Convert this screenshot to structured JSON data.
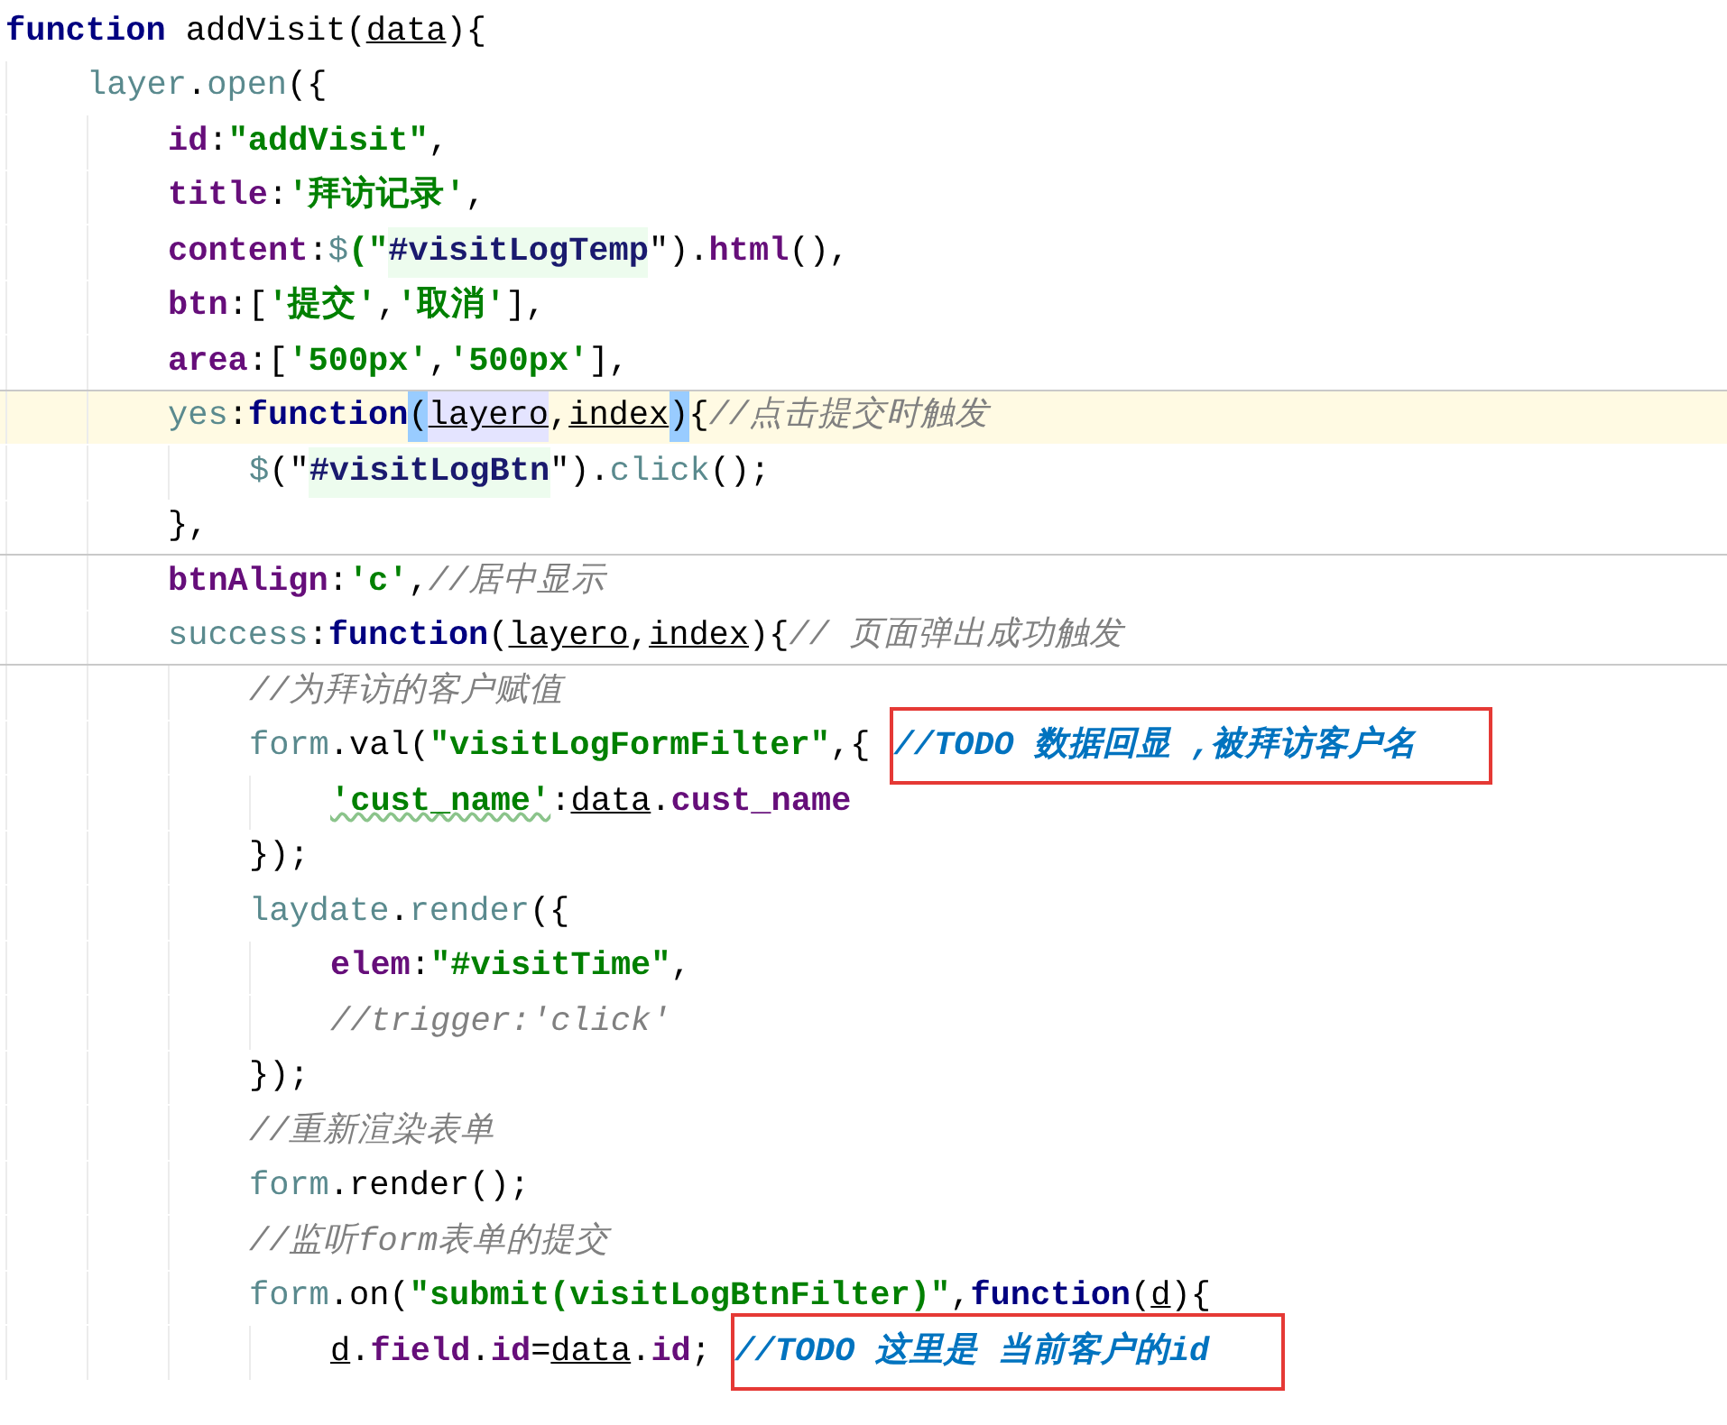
{
  "code_lines": [
    {
      "tokens": [
        {
          "text": "function",
          "kind": "keyword"
        },
        {
          "text": " addVisit(",
          "kind": "plain"
        },
        {
          "text": "data",
          "kind": "param"
        },
        {
          "text": "){",
          "kind": "plain"
        }
      ],
      "children": [
        {
          "tokens": [
            {
              "text": "layer",
              "kind": "ident"
            },
            {
              "text": ".",
              "kind": "plain"
            },
            {
              "text": "open",
              "kind": "ident"
            },
            {
              "text": "({",
              "kind": "plain"
            }
          ],
          "children": [
            {
              "tokens": [
                {
                  "text": "id",
                  "kind": "prop"
                },
                {
                  "text": ":",
                  "kind": "plain"
                },
                {
                  "text": "\"addVisit\"",
                  "kind": "string"
                },
                {
                  "text": ",",
                  "kind": "plain"
                }
              ]
            },
            {
              "tokens": [
                {
                  "text": "title",
                  "kind": "prop"
                },
                {
                  "text": ":",
                  "kind": "plain"
                },
                {
                  "text": "'拜访记录'",
                  "kind": "string"
                },
                {
                  "text": ",",
                  "kind": "plain"
                }
              ]
            },
            {
              "tokens": [
                {
                  "text": "content",
                  "kind": "prop"
                },
                {
                  "text": ":",
                  "kind": "plain"
                },
                {
                  "text": "$",
                  "kind": "ident"
                },
                {
                  "text": "(\"",
                  "kind": "string"
                },
                {
                  "text": "#visitLogTemp",
                  "kind": "selector"
                },
                {
                  "text": "\").",
                  "kind": "plain"
                },
                {
                  "text": "html",
                  "kind": "prop"
                },
                {
                  "text": "(),",
                  "kind": "plain"
                }
              ]
            },
            {
              "tokens": [
                {
                  "text": "btn",
                  "kind": "prop"
                },
                {
                  "text": ":[",
                  "kind": "plain"
                },
                {
                  "text": "'提交'",
                  "kind": "string"
                },
                {
                  "text": ",",
                  "kind": "plain"
                },
                {
                  "text": "'取消'",
                  "kind": "string"
                },
                {
                  "text": "],",
                  "kind": "plain"
                }
              ]
            },
            {
              "tokens": [
                {
                  "text": "area",
                  "kind": "prop"
                },
                {
                  "text": ":[",
                  "kind": "plain"
                },
                {
                  "text": "'500px'",
                  "kind": "string"
                },
                {
                  "text": ",",
                  "kind": "plain"
                },
                {
                  "text": "'500px'",
                  "kind": "string"
                },
                {
                  "text": "],",
                  "kind": "plain"
                }
              ]
            },
            {
              "current": true,
              "separator_above": true,
              "tokens": [
                {
                  "text": "yes",
                  "kind": "ident"
                },
                {
                  "text": ":",
                  "kind": "plain"
                },
                {
                  "text": "function",
                  "kind": "keyword"
                },
                {
                  "text": "(",
                  "kind": "brace_match"
                },
                {
                  "text": "layero",
                  "kind": "param_highlight"
                },
                {
                  "text": ",",
                  "kind": "plain"
                },
                {
                  "text": "index",
                  "kind": "param"
                },
                {
                  "text": ")",
                  "kind": "brace_match"
                },
                {
                  "text": "{",
                  "kind": "plain"
                },
                {
                  "text": "//点击提交时触发",
                  "kind": "comment"
                }
              ],
              "children": [
                {
                  "tokens": [
                    {
                      "text": "$",
                      "kind": "ident"
                    },
                    {
                      "text": "(\"",
                      "kind": "plain"
                    },
                    {
                      "text": "#visitLogBtn",
                      "kind": "selector"
                    },
                    {
                      "text": "\").",
                      "kind": "plain"
                    },
                    {
                      "text": "click",
                      "kind": "ident"
                    },
                    {
                      "text": "();",
                      "kind": "plain"
                    }
                  ]
                }
              ]
            },
            {
              "tokens": [
                {
                  "text": "},",
                  "kind": "plain"
                }
              ]
            },
            {
              "separator_above": true,
              "tokens": [
                {
                  "text": "btnAlign",
                  "kind": "prop"
                },
                {
                  "text": ":",
                  "kind": "plain"
                },
                {
                  "text": "'c'",
                  "kind": "string"
                },
                {
                  "text": ",",
                  "kind": "plain"
                },
                {
                  "text": "//居中显示",
                  "kind": "comment"
                }
              ]
            },
            {
              "tokens": [
                {
                  "text": "success",
                  "kind": "ident"
                },
                {
                  "text": ":",
                  "kind": "plain"
                },
                {
                  "text": "function",
                  "kind": "keyword"
                },
                {
                  "text": "(",
                  "kind": "plain"
                },
                {
                  "text": "layero",
                  "kind": "param"
                },
                {
                  "text": ",",
                  "kind": "plain"
                },
                {
                  "text": "index",
                  "kind": "param"
                },
                {
                  "text": "){",
                  "kind": "plain"
                },
                {
                  "text": "// 页面弹出成功触发",
                  "kind": "comment"
                }
              ],
              "children": [
                {
                  "separator_above": true,
                  "tokens": [
                    {
                      "text": "//为拜访的客户赋值",
                      "kind": "comment"
                    }
                  ]
                },
                {
                  "tokens": [
                    {
                      "text": "form",
                      "kind": "ident"
                    },
                    {
                      "text": ".val(",
                      "kind": "plain"
                    },
                    {
                      "text": "\"visitLogFormFilter\"",
                      "kind": "string"
                    },
                    {
                      "text": ",{ ",
                      "kind": "plain"
                    },
                    {
                      "text": "//TODO 数据回显 ,被拜访客户名",
                      "kind": "todo",
                      "boxed": true
                    }
                  ],
                  "children": [
                    {
                      "tokens": [
                        {
                          "text": "'cust_name'",
                          "kind": "string_warn"
                        },
                        {
                          "text": ":",
                          "kind": "plain"
                        },
                        {
                          "text": "data",
                          "kind": "param"
                        },
                        {
                          "text": ".",
                          "kind": "plain"
                        },
                        {
                          "text": "cust_name",
                          "kind": "prop"
                        }
                      ]
                    }
                  ]
                },
                {
                  "tokens": [
                    {
                      "text": "});",
                      "kind": "plain"
                    }
                  ]
                },
                {
                  "tokens": [
                    {
                      "text": "laydate",
                      "kind": "ident"
                    },
                    {
                      "text": ".",
                      "kind": "plain"
                    },
                    {
                      "text": "render",
                      "kind": "ident"
                    },
                    {
                      "text": "({",
                      "kind": "plain"
                    }
                  ],
                  "children": [
                    {
                      "tokens": [
                        {
                          "text": "elem",
                          "kind": "prop"
                        },
                        {
                          "text": ":",
                          "kind": "plain"
                        },
                        {
                          "text": "\"#visitTime\"",
                          "kind": "string"
                        },
                        {
                          "text": ",",
                          "kind": "plain"
                        }
                      ]
                    },
                    {
                      "tokens": [
                        {
                          "text": "//trigger:'click'",
                          "kind": "comment"
                        }
                      ]
                    }
                  ]
                },
                {
                  "tokens": [
                    {
                      "text": "});",
                      "kind": "plain"
                    }
                  ]
                },
                {
                  "tokens": [
                    {
                      "text": "//重新渲染表单",
                      "kind": "comment"
                    }
                  ]
                },
                {
                  "tokens": [
                    {
                      "text": "form",
                      "kind": "ident"
                    },
                    {
                      "text": ".render();",
                      "kind": "plain"
                    }
                  ]
                },
                {
                  "tokens": [
                    {
                      "text": "//监听form表单的提交",
                      "kind": "comment"
                    }
                  ]
                },
                {
                  "tokens": [
                    {
                      "text": "form",
                      "kind": "ident"
                    },
                    {
                      "text": ".on(",
                      "kind": "plain"
                    },
                    {
                      "text": "\"submit(visitLogBtnFilter)\"",
                      "kind": "string"
                    },
                    {
                      "text": ",",
                      "kind": "plain"
                    },
                    {
                      "text": "function",
                      "kind": "keyword"
                    },
                    {
                      "text": "(",
                      "kind": "plain"
                    },
                    {
                      "text": "d",
                      "kind": "param"
                    },
                    {
                      "text": "){",
                      "kind": "plain"
                    }
                  ],
                  "children": [
                    {
                      "tokens": [
                        {
                          "text": "d",
                          "kind": "param"
                        },
                        {
                          "text": ".",
                          "kind": "plain"
                        },
                        {
                          "text": "field",
                          "kind": "prop"
                        },
                        {
                          "text": ".",
                          "kind": "plain"
                        },
                        {
                          "text": "id",
                          "kind": "prop"
                        },
                        {
                          "text": "=",
                          "kind": "plain"
                        },
                        {
                          "text": "data",
                          "kind": "param"
                        },
                        {
                          "text": ".",
                          "kind": "plain"
                        },
                        {
                          "text": "id",
                          "kind": "prop"
                        },
                        {
                          "text": "; ",
                          "kind": "plain"
                        },
                        {
                          "text": "//TODO 这里是 当前客户的id",
                          "kind": "todo",
                          "boxed": true
                        }
                      ]
                    }
                  ]
                }
              ]
            }
          ]
        }
      ]
    }
  ]
}
